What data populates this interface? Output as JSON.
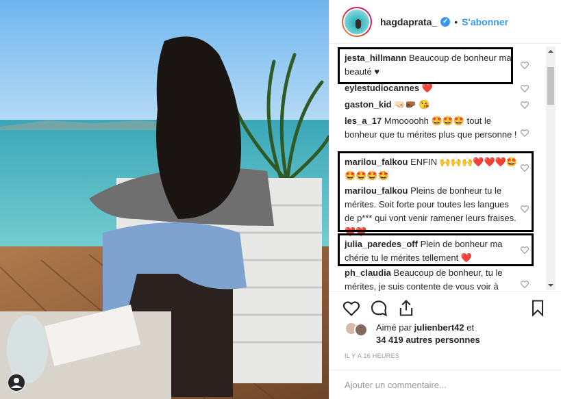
{
  "post": {
    "username": "hagdaprata_",
    "verified_icon": "verified-check-icon",
    "separator": "•",
    "follow_label": "S'abonner"
  },
  "comments": [
    {
      "author": "jesta_hillmann",
      "text": "Beaucoup de bonheur ma beauté ♥"
    },
    {
      "author": "eylestudiocannes",
      "text": "❤️"
    },
    {
      "author": "gaston_kid",
      "text": "🤜🏻🤛🏾 😘"
    },
    {
      "author": "les_a_17",
      "text": "Mmoooohh 🤩🤩🤩 tout le bonheur que tu mérites plus que personne !"
    },
    {
      "author": "marilou_falkou",
      "text": "ENFIN 🙌🙌🙌❤️❤️❤️🤩🤩🤩🤩🤩"
    },
    {
      "author": "marilou_falkou",
      "text": "Pleins de bonheur tu le mérites. Soit forte pour toutes les langues de p*** qui vont venir ramener leurs fraises. ❤️❤️"
    },
    {
      "author": "julia_paredes_off",
      "text": "Plein de bonheur ma chérie tu le mérites tellement ❤️"
    },
    {
      "author": "ph_claudia",
      "text": "Beaucoup de bonheur, tu le mérites, je suis contente de vous voir à"
    }
  ],
  "likes": {
    "prefix": "Aimé par",
    "user": "julienbert42",
    "conjunction": "et",
    "count": "34 419 autres personnes"
  },
  "timestamp": "IL Y A 16 HEURES",
  "add_comment_placeholder": "Ajouter un commentaire...",
  "colors": {
    "accent": "#3897f0",
    "text": "#262626",
    "muted": "#999999",
    "like_heart": "#ed4956"
  },
  "icons": [
    "like-icon",
    "comment-icon",
    "share-icon",
    "bookmark-icon",
    "heart-outline-icon"
  ]
}
